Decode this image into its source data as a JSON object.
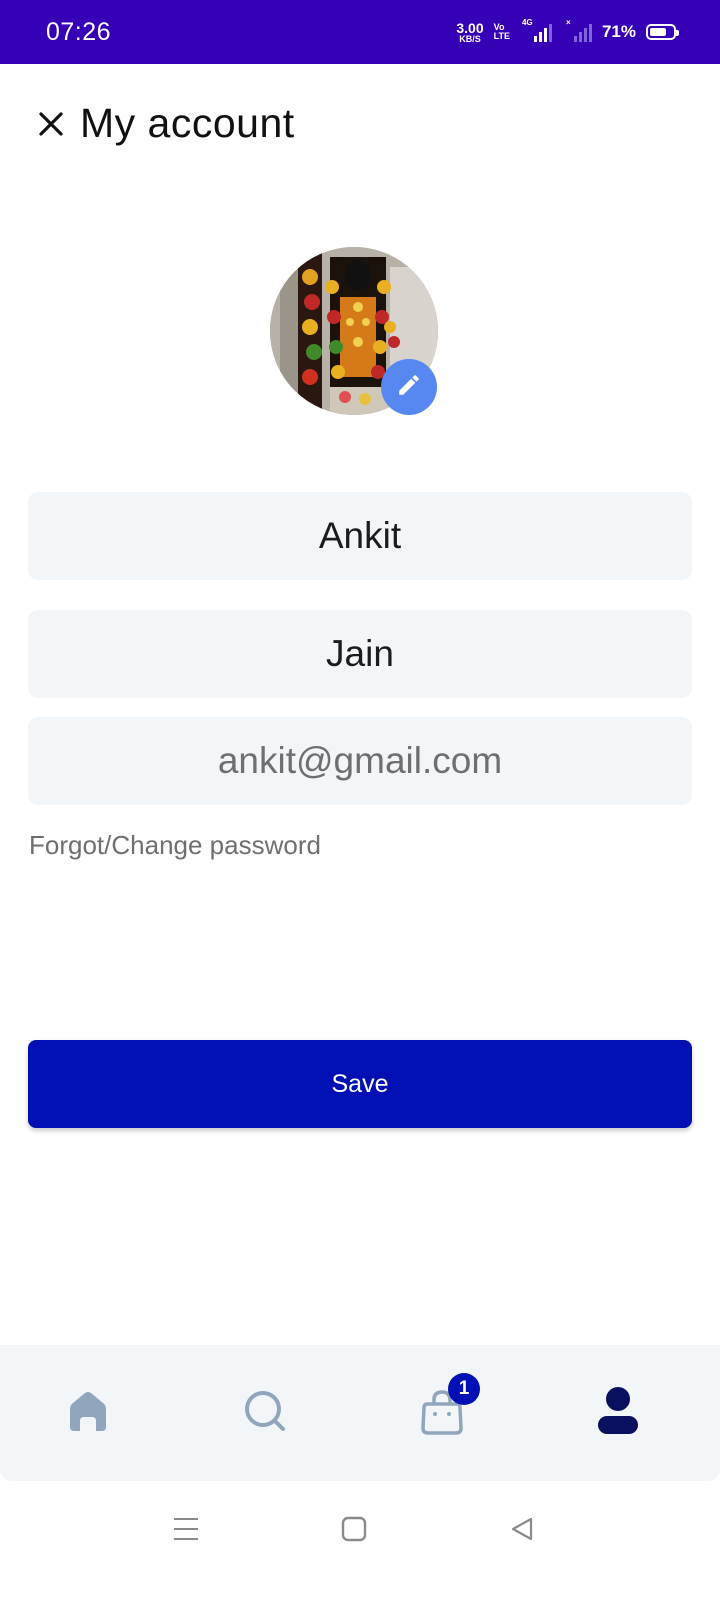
{
  "status_bar": {
    "time": "07:26",
    "net_speed_value": "3.00",
    "net_speed_unit": "KB/S",
    "volte_top": "Vo",
    "volte_bottom": "LTE",
    "network_type": "4G",
    "battery_percent": "71%",
    "battery_level": 0.71
  },
  "header": {
    "title": "My account",
    "close_icon": "close-icon"
  },
  "profile": {
    "avatar_icon": "avatar",
    "edit_icon": "pencil-icon"
  },
  "form": {
    "first_name": "Ankit",
    "last_name": "Jain",
    "email": "ankit@gmail.com",
    "forgot_link": "Forgot/Change password"
  },
  "save_label": "Save",
  "bottom_nav": {
    "items": [
      {
        "name": "home",
        "icon": "home-icon",
        "active": false
      },
      {
        "name": "search",
        "icon": "search-icon",
        "active": false
      },
      {
        "name": "cart",
        "icon": "shopping-bag-icon",
        "badge": "1",
        "active": false
      },
      {
        "name": "account",
        "icon": "user-icon",
        "active": true
      }
    ]
  },
  "colors": {
    "status_bar": "#3500b6",
    "primary": "#0010b4",
    "edit_badge": "#5787f0",
    "field_bg": "#f3f6f9",
    "nav_inactive": "#91a6bd",
    "nav_active": "#0a1060"
  }
}
